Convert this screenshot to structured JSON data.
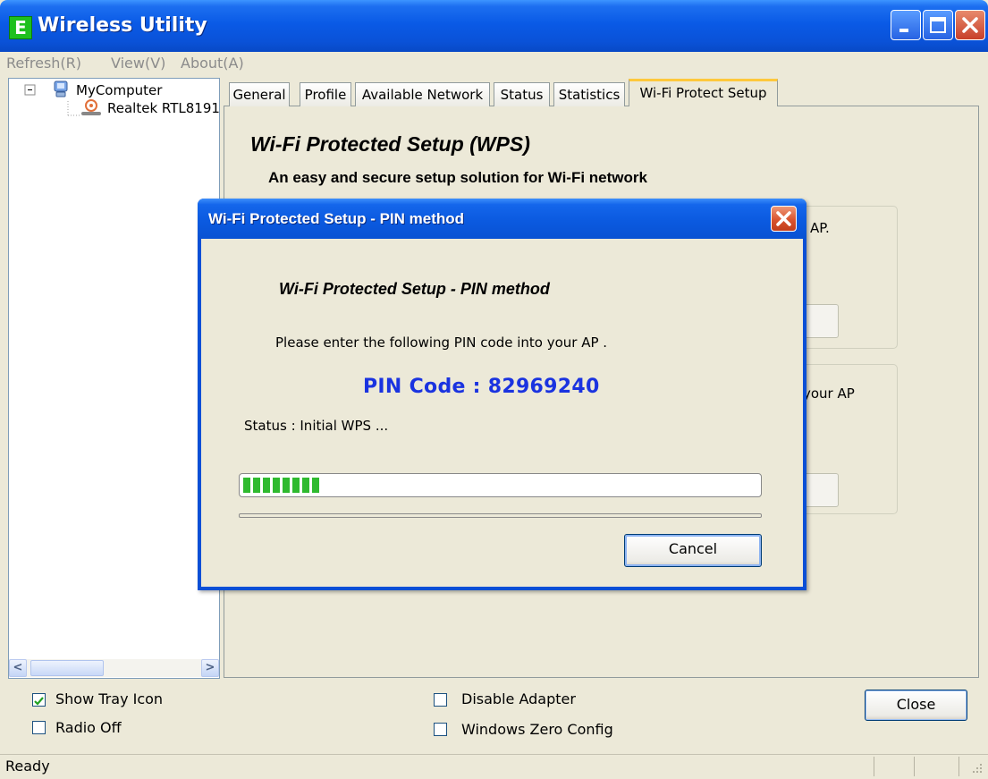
{
  "window": {
    "title": "Wireless Utility",
    "icon_letter": "E"
  },
  "menu": [
    "Refresh(R)",
    "View(V)",
    "About(A)"
  ],
  "tree": {
    "root": "MyComputer",
    "adapter": "Realtek RTL8191"
  },
  "tabs": [
    "General",
    "Profile",
    "Available Network",
    "Status",
    "Statistics",
    "Wi-Fi Protect Setup"
  ],
  "active_tab": "Wi-Fi Protect Setup",
  "wps": {
    "title": "Wi-Fi Protected Setup (WPS)",
    "subtitle": "An easy and secure setup solution for Wi-Fi network",
    "partial_text_1": "AP.",
    "partial_text_2": "your AP"
  },
  "options": {
    "show_tray_icon": {
      "label": "Show Tray Icon",
      "checked": true
    },
    "radio_off": {
      "label": "Radio Off",
      "checked": false
    },
    "disable_adapter": {
      "label": "Disable Adapter",
      "checked": false
    },
    "windows_zero_config": {
      "label": "Windows Zero Config",
      "checked": false
    }
  },
  "close_label": "Close",
  "status_bar": "Ready",
  "dialog": {
    "title": "Wi-Fi Protected Setup - PIN method",
    "heading": "Wi-Fi Protected Setup - PIN method",
    "message": "Please enter the following PIN code into your AP .",
    "pin_label": "PIN Code :  82969240",
    "status": "Status :  Initial WPS ...",
    "progress": 0.16,
    "cancel_label": "Cancel"
  },
  "colors": {
    "titlebar": "#0a5ae6",
    "pin_text": "#1a33e0",
    "progress": "#2fba2f",
    "window_bg": "#ece9d8"
  }
}
